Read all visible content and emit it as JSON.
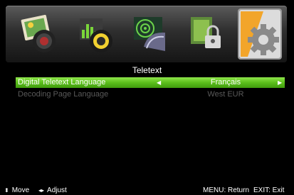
{
  "menu": {
    "title": "Teletext",
    "categories": [
      {
        "name": "picture",
        "icon": "picture-icon",
        "active": false
      },
      {
        "name": "sound",
        "icon": "sound-icon",
        "active": false
      },
      {
        "name": "channel",
        "icon": "channel-icon",
        "active": false
      },
      {
        "name": "lock",
        "icon": "lock-icon",
        "active": false
      },
      {
        "name": "setup",
        "icon": "gear-icon",
        "active": true
      }
    ],
    "items": [
      {
        "label": "Digital Teletext Language",
        "value": "Français",
        "selected": true,
        "enabled": true
      },
      {
        "label": "Decoding Page Language",
        "value": "West EUR",
        "selected": false,
        "enabled": false
      }
    ]
  },
  "help": {
    "move_glyph": "⬍",
    "move": "Move",
    "adjust_glyph": "◂▸",
    "adjust": "Adjust",
    "menu": "MENU: Return",
    "exit": "EXIT: Exit"
  },
  "colors": {
    "highlight": "#5cbf1c",
    "disabled_text": "#5a5a5a",
    "background": "#000000"
  }
}
